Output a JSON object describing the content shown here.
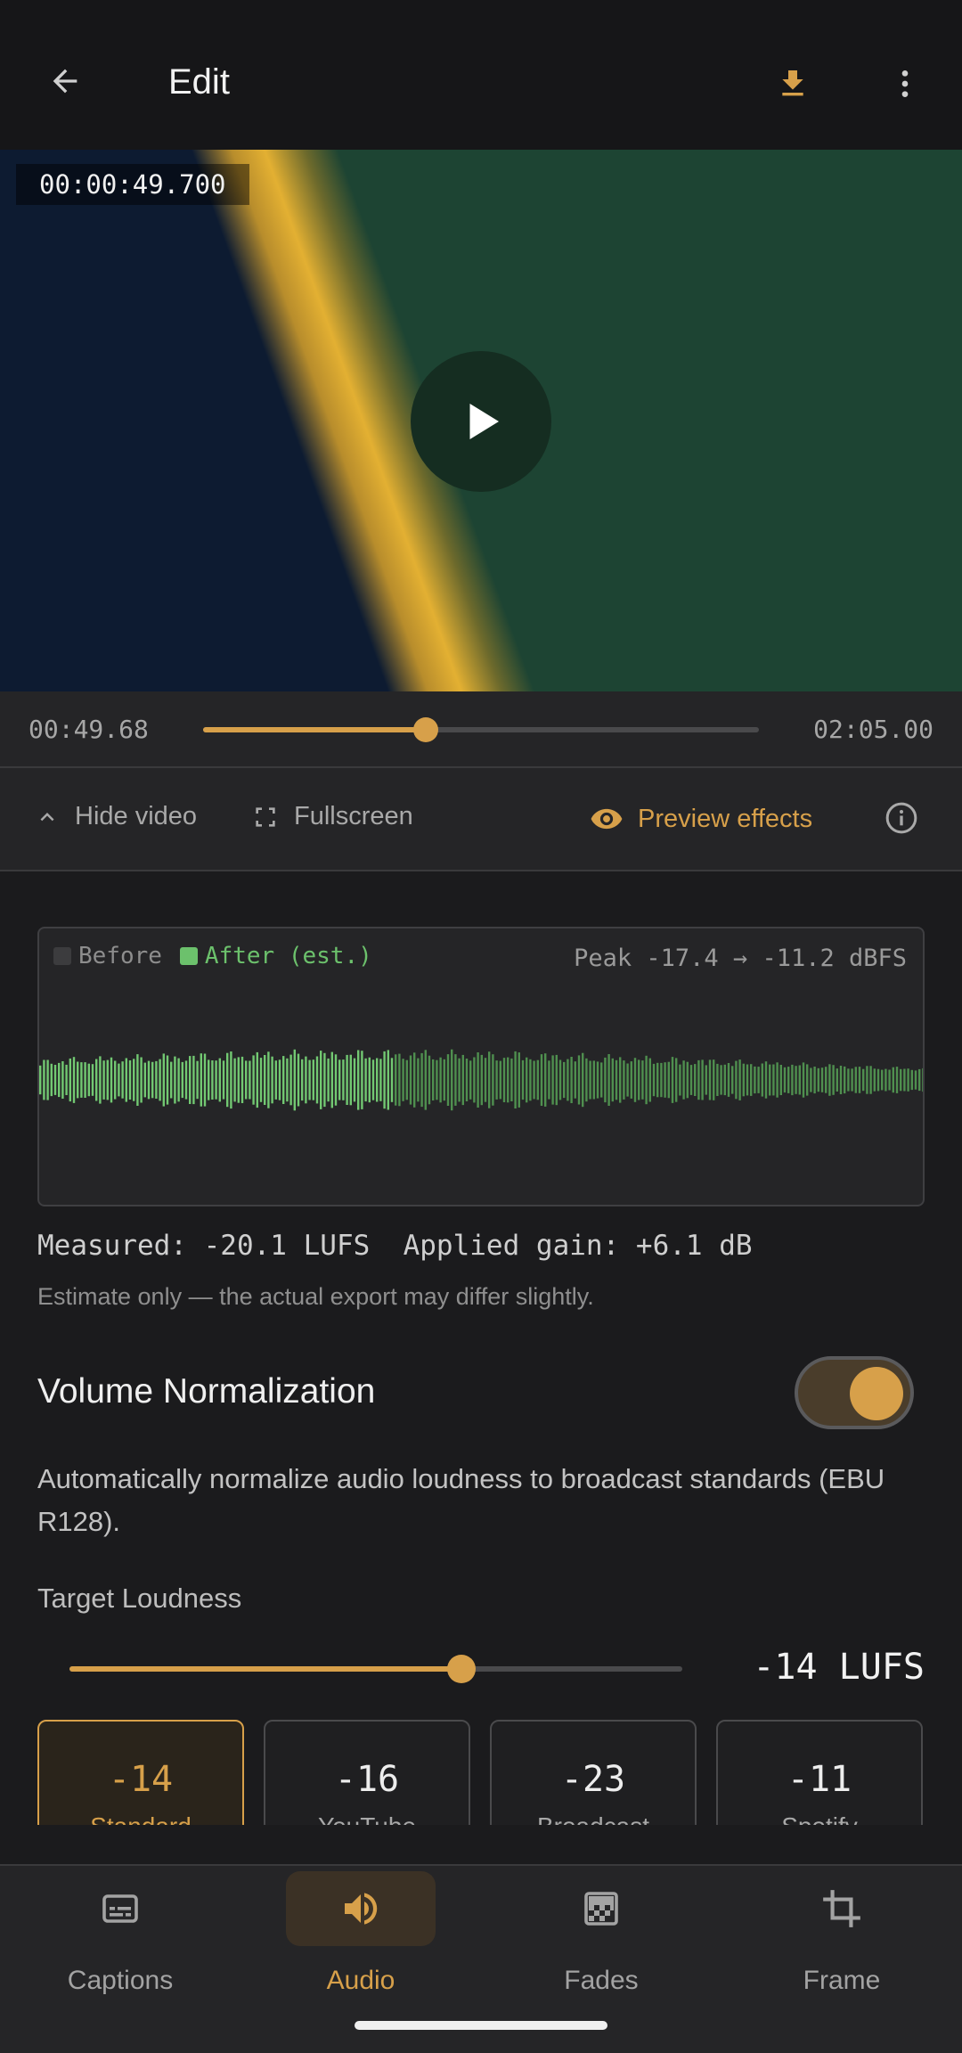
{
  "appbar": {
    "title": "Edit",
    "back_icon": "arrow-left-icon",
    "download_icon": "download-icon",
    "more_icon": "more-vertical-icon"
  },
  "video": {
    "timecode": "00:00:49.700",
    "play_icon": "play-icon"
  },
  "scrubber": {
    "current": "00:49.68",
    "duration": "02:05.00",
    "progress_fraction": 0.4
  },
  "controls": {
    "hide_video": "Hide video",
    "fullscreen": "Fullscreen",
    "preview_effects": "Preview effects",
    "info_icon": "info-icon"
  },
  "waveform": {
    "legend_before": "Before",
    "legend_after": "After (est.)",
    "peak": "Peak -17.4 → -11.2 dBFS",
    "before_color": "#3c3c3e",
    "after_color": "#6cc16c"
  },
  "measurement": {
    "measured": "Measured: -20.1 LUFS",
    "applied_gain": "Applied gain: +6.1 dB",
    "note": "Estimate only — the actual export may differ slightly."
  },
  "normalization": {
    "title": "Volume Normalization",
    "enabled": true,
    "description": "Automatically normalize audio loudness to broadcast standards (EBU R128).",
    "target_label": "Target Loudness",
    "target_value": "-14 LUFS",
    "target_fraction": 0.64
  },
  "presets": [
    {
      "value": "-14",
      "name": "Standard",
      "selected": true
    },
    {
      "value": "-16",
      "name": "YouTube",
      "selected": false
    },
    {
      "value": "-23",
      "name": "Broadcast",
      "selected": false
    },
    {
      "value": "-11",
      "name": "Spotify",
      "selected": false
    }
  ],
  "nav": [
    {
      "label": "Captions",
      "icon": "captions-icon",
      "active": false
    },
    {
      "label": "Audio",
      "icon": "volume-icon",
      "active": true
    },
    {
      "label": "Fades",
      "icon": "gradient-icon",
      "active": false
    },
    {
      "label": "Frame",
      "icon": "crop-icon",
      "active": false
    }
  ],
  "colors": {
    "accent": "#d7a04a",
    "background": "#1b1b1d",
    "surface": "#252527"
  }
}
